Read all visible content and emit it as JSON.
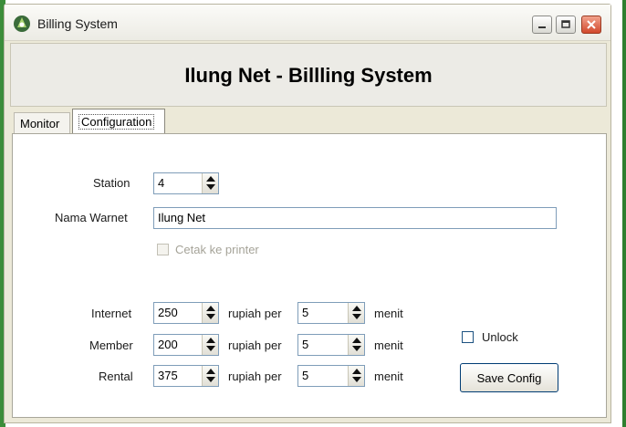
{
  "window": {
    "title": "Billing System",
    "icon": "app-logo-icon",
    "controls": [
      "minimize-icon",
      "maximize-icon",
      "close-icon"
    ]
  },
  "header": {
    "title": "Ilung Net - Billling System"
  },
  "tabs": [
    {
      "label": "Monitor",
      "active": false
    },
    {
      "label": "Configuration",
      "active": true
    }
  ],
  "config": {
    "station": {
      "label": "Station",
      "value": "4"
    },
    "nama_warnet": {
      "label": "Nama Warnet",
      "value": "Ilung Net"
    },
    "cetak": {
      "label": "Cetak ke printer",
      "checked": false,
      "enabled": false
    },
    "rates": [
      {
        "label": "Internet",
        "price": "250",
        "per_label": "rupiah per",
        "minutes": "5",
        "unit": "menit"
      },
      {
        "label": "Member",
        "price": "200",
        "per_label": "rupiah per",
        "minutes": "5",
        "unit": "menit"
      },
      {
        "label": "Rental",
        "price": "375",
        "per_label": "rupiah per",
        "minutes": "5",
        "unit": "menit"
      }
    ],
    "unlock": {
      "label": "Unlock",
      "checked": false
    },
    "save_button": "Save Config"
  },
  "colors": {
    "window_bg": "#ece9d8",
    "close_button": "#d1492c",
    "field_border": "#7f9db9",
    "desktop_green": "#3c8d3a"
  }
}
